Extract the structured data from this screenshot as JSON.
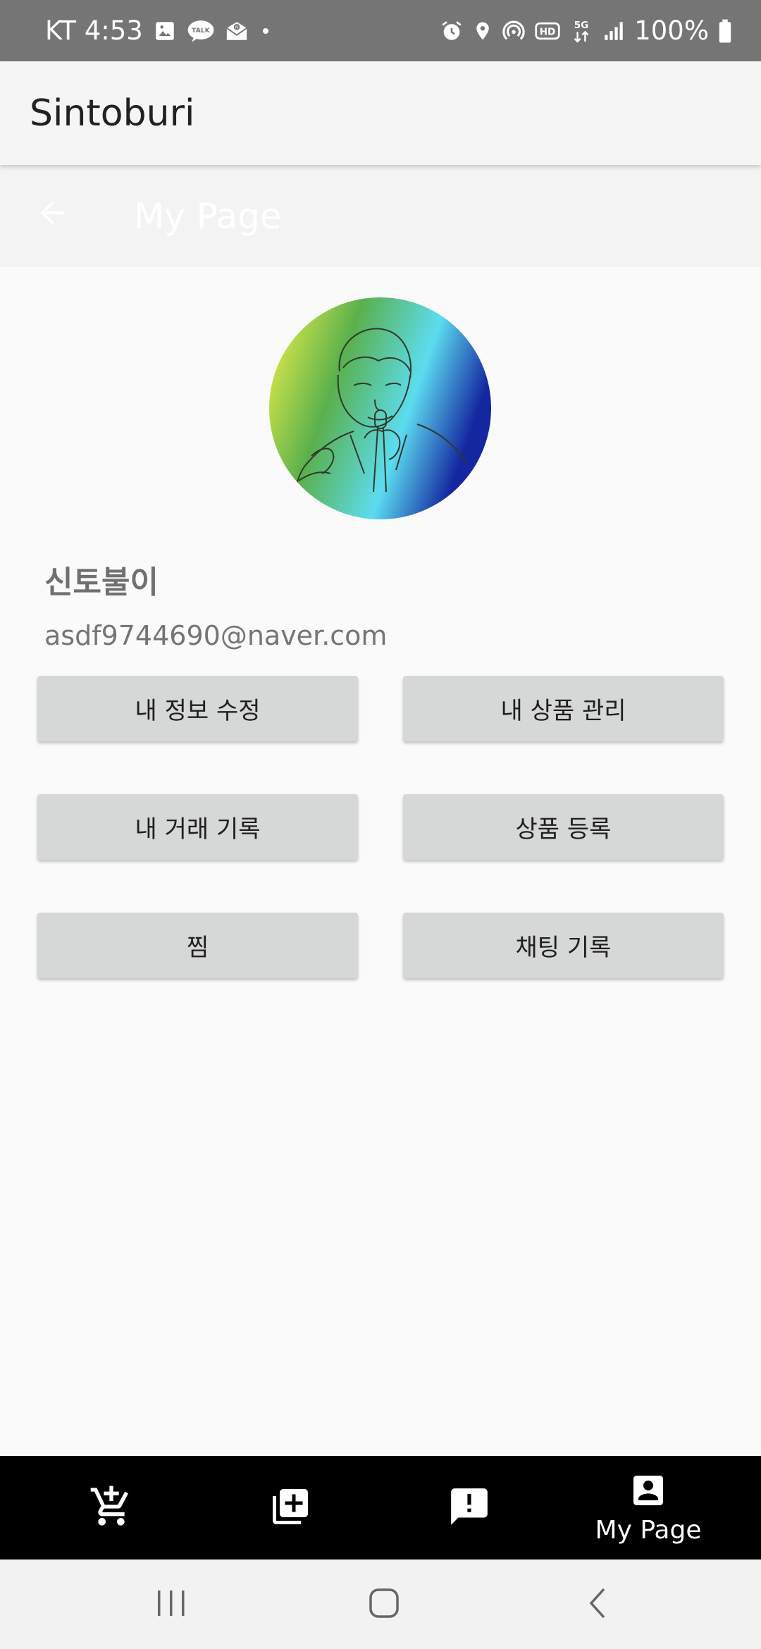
{
  "status_bar": {
    "carrier_time": "KT 4:53",
    "battery": "100%",
    "left_icons": [
      "gallery-icon",
      "kakaotalk-icon",
      "mail-icon",
      "dot-icon"
    ],
    "right_icons": [
      "alarm-icon",
      "location-icon",
      "hotspot-icon",
      "hd-icon",
      "5g-icon",
      "signal-icon",
      "battery-icon"
    ]
  },
  "app_bar": {
    "title": "Sintoburi"
  },
  "sub_bar": {
    "title": "My Page",
    "back_icon": "arrow-left-icon"
  },
  "profile": {
    "name": "신토불이",
    "email": "asdf9744690@naver.com",
    "avatar_colors": [
      "#f7f54a",
      "#5ab04c",
      "#5cdcf0",
      "#1426a0"
    ]
  },
  "actions": {
    "edit_info": "내 정보 수정",
    "manage_products": "내 상품 관리",
    "transaction_history": "내 거래 기록",
    "register_product": "상품 등록",
    "wishlist": "찜",
    "chat_history": "채팅 기록"
  },
  "bottom_nav": {
    "items": [
      {
        "icon": "add-to-cart-icon",
        "label": ""
      },
      {
        "icon": "add-box-icon",
        "label": ""
      },
      {
        "icon": "report-icon",
        "label": ""
      },
      {
        "icon": "account-box-icon",
        "label": "My Page"
      }
    ]
  },
  "system_nav": {
    "icons": [
      "recent-apps-icon",
      "home-icon",
      "back-icon"
    ]
  },
  "colors": {
    "status_bar": "#757575",
    "button": "#d6d7d7",
    "bottom_nav": "#000000"
  }
}
